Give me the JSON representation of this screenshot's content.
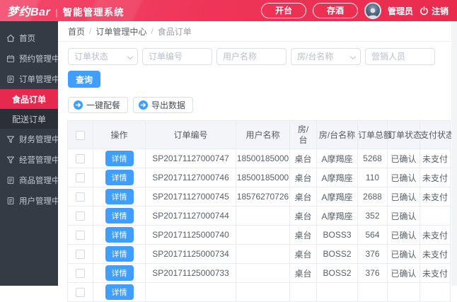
{
  "header": {
    "logo_brand": "梦约Bar",
    "logo_divider": "|",
    "logo_product": "智能管理系统",
    "open_table_label": "开台",
    "store_wine_label": "存酒",
    "username": "管理员",
    "logout_label": "注销"
  },
  "colors": {
    "header_red": "#ee3558",
    "active_menu_red": "#e72950",
    "sidebar_dark": "#353b45",
    "primary_blue": "#409eff"
  },
  "sidebar": {
    "items": [
      {
        "label": "首页",
        "icon": "home-icon",
        "type": "parent",
        "active": false
      },
      {
        "label": "预约管理中心",
        "icon": "calendar-icon",
        "type": "parent",
        "active": false
      },
      {
        "label": "订单管理中心",
        "icon": "file-icon",
        "type": "parent",
        "active": false
      },
      {
        "label": "食品订单",
        "icon": "",
        "type": "sub",
        "active": true
      },
      {
        "label": "配送订单",
        "icon": "",
        "type": "sub",
        "active": false
      },
      {
        "label": "财务管理中心",
        "icon": "funnel-icon",
        "type": "parent",
        "active": false
      },
      {
        "label": "经营管理中心",
        "icon": "funnel-icon",
        "type": "parent",
        "active": false
      },
      {
        "label": "商品管理中心",
        "icon": "file-icon",
        "type": "parent",
        "active": false
      },
      {
        "label": "用户管理中心",
        "icon": "file-icon",
        "type": "parent",
        "active": false
      }
    ]
  },
  "breadcrumb": {
    "separator": "/",
    "items": [
      "首页",
      "订单管理中心",
      "食品订单"
    ]
  },
  "filters": {
    "order_status_placeholder": "订单状态",
    "order_no_placeholder": "订单编号",
    "user_name_placeholder": "用户名称",
    "room_name_placeholder": "房/台名称",
    "marketer_placeholder": "营销人员",
    "search_label": "查询"
  },
  "toolbar": {
    "dispatch_label": "一键配餐",
    "export_label": "导出数据"
  },
  "table": {
    "detail_label": "详情",
    "columns": {
      "op": "操作",
      "order_no": "订单编号",
      "user": "用户名称",
      "room_type": "房/台",
      "room_name": "房/台名称",
      "total": "订单总额",
      "status": "订单状态",
      "pay_status": "支付状态"
    },
    "rows": [
      {
        "order_no": "SP20171127000747",
        "user": "18500185000",
        "room_type": "桌台",
        "room_name": "A摩羯座",
        "total": "5268",
        "status": "已确认",
        "pay_status": "未支付"
      },
      {
        "order_no": "SP20171127000746",
        "user": "18500185000",
        "room_type": "桌台",
        "room_name": "A摩羯座",
        "total": "110",
        "status": "已确认",
        "pay_status": "未支付"
      },
      {
        "order_no": "SP20171127000745",
        "user": "18576270726",
        "room_type": "桌台",
        "room_name": "A摩羯座",
        "total": "2688",
        "status": "已确认",
        "pay_status": "未支付"
      },
      {
        "order_no": "SP20171127000744",
        "user": "",
        "room_type": "桌台",
        "room_name": "A摩羯座",
        "total": "352",
        "status": "已确认",
        "pay_status": ""
      },
      {
        "order_no": "SP20171125000740",
        "user": "",
        "room_type": "桌台",
        "room_name": "BOSS3",
        "total": "564",
        "status": "已确认",
        "pay_status": "未支付"
      },
      {
        "order_no": "SP20171125000734",
        "user": "",
        "room_type": "桌台",
        "room_name": "BOSS2",
        "total": "376",
        "status": "已确认",
        "pay_status": "未支付"
      },
      {
        "order_no": "SP20171125000733",
        "user": "",
        "room_type": "桌台",
        "room_name": "BOSS2",
        "total": "376",
        "status": "已确认",
        "pay_status": "未支付"
      },
      {
        "order_no": "",
        "user": "",
        "room_type": "",
        "room_name": "",
        "total": "",
        "status": "",
        "pay_status": ""
      }
    ]
  }
}
